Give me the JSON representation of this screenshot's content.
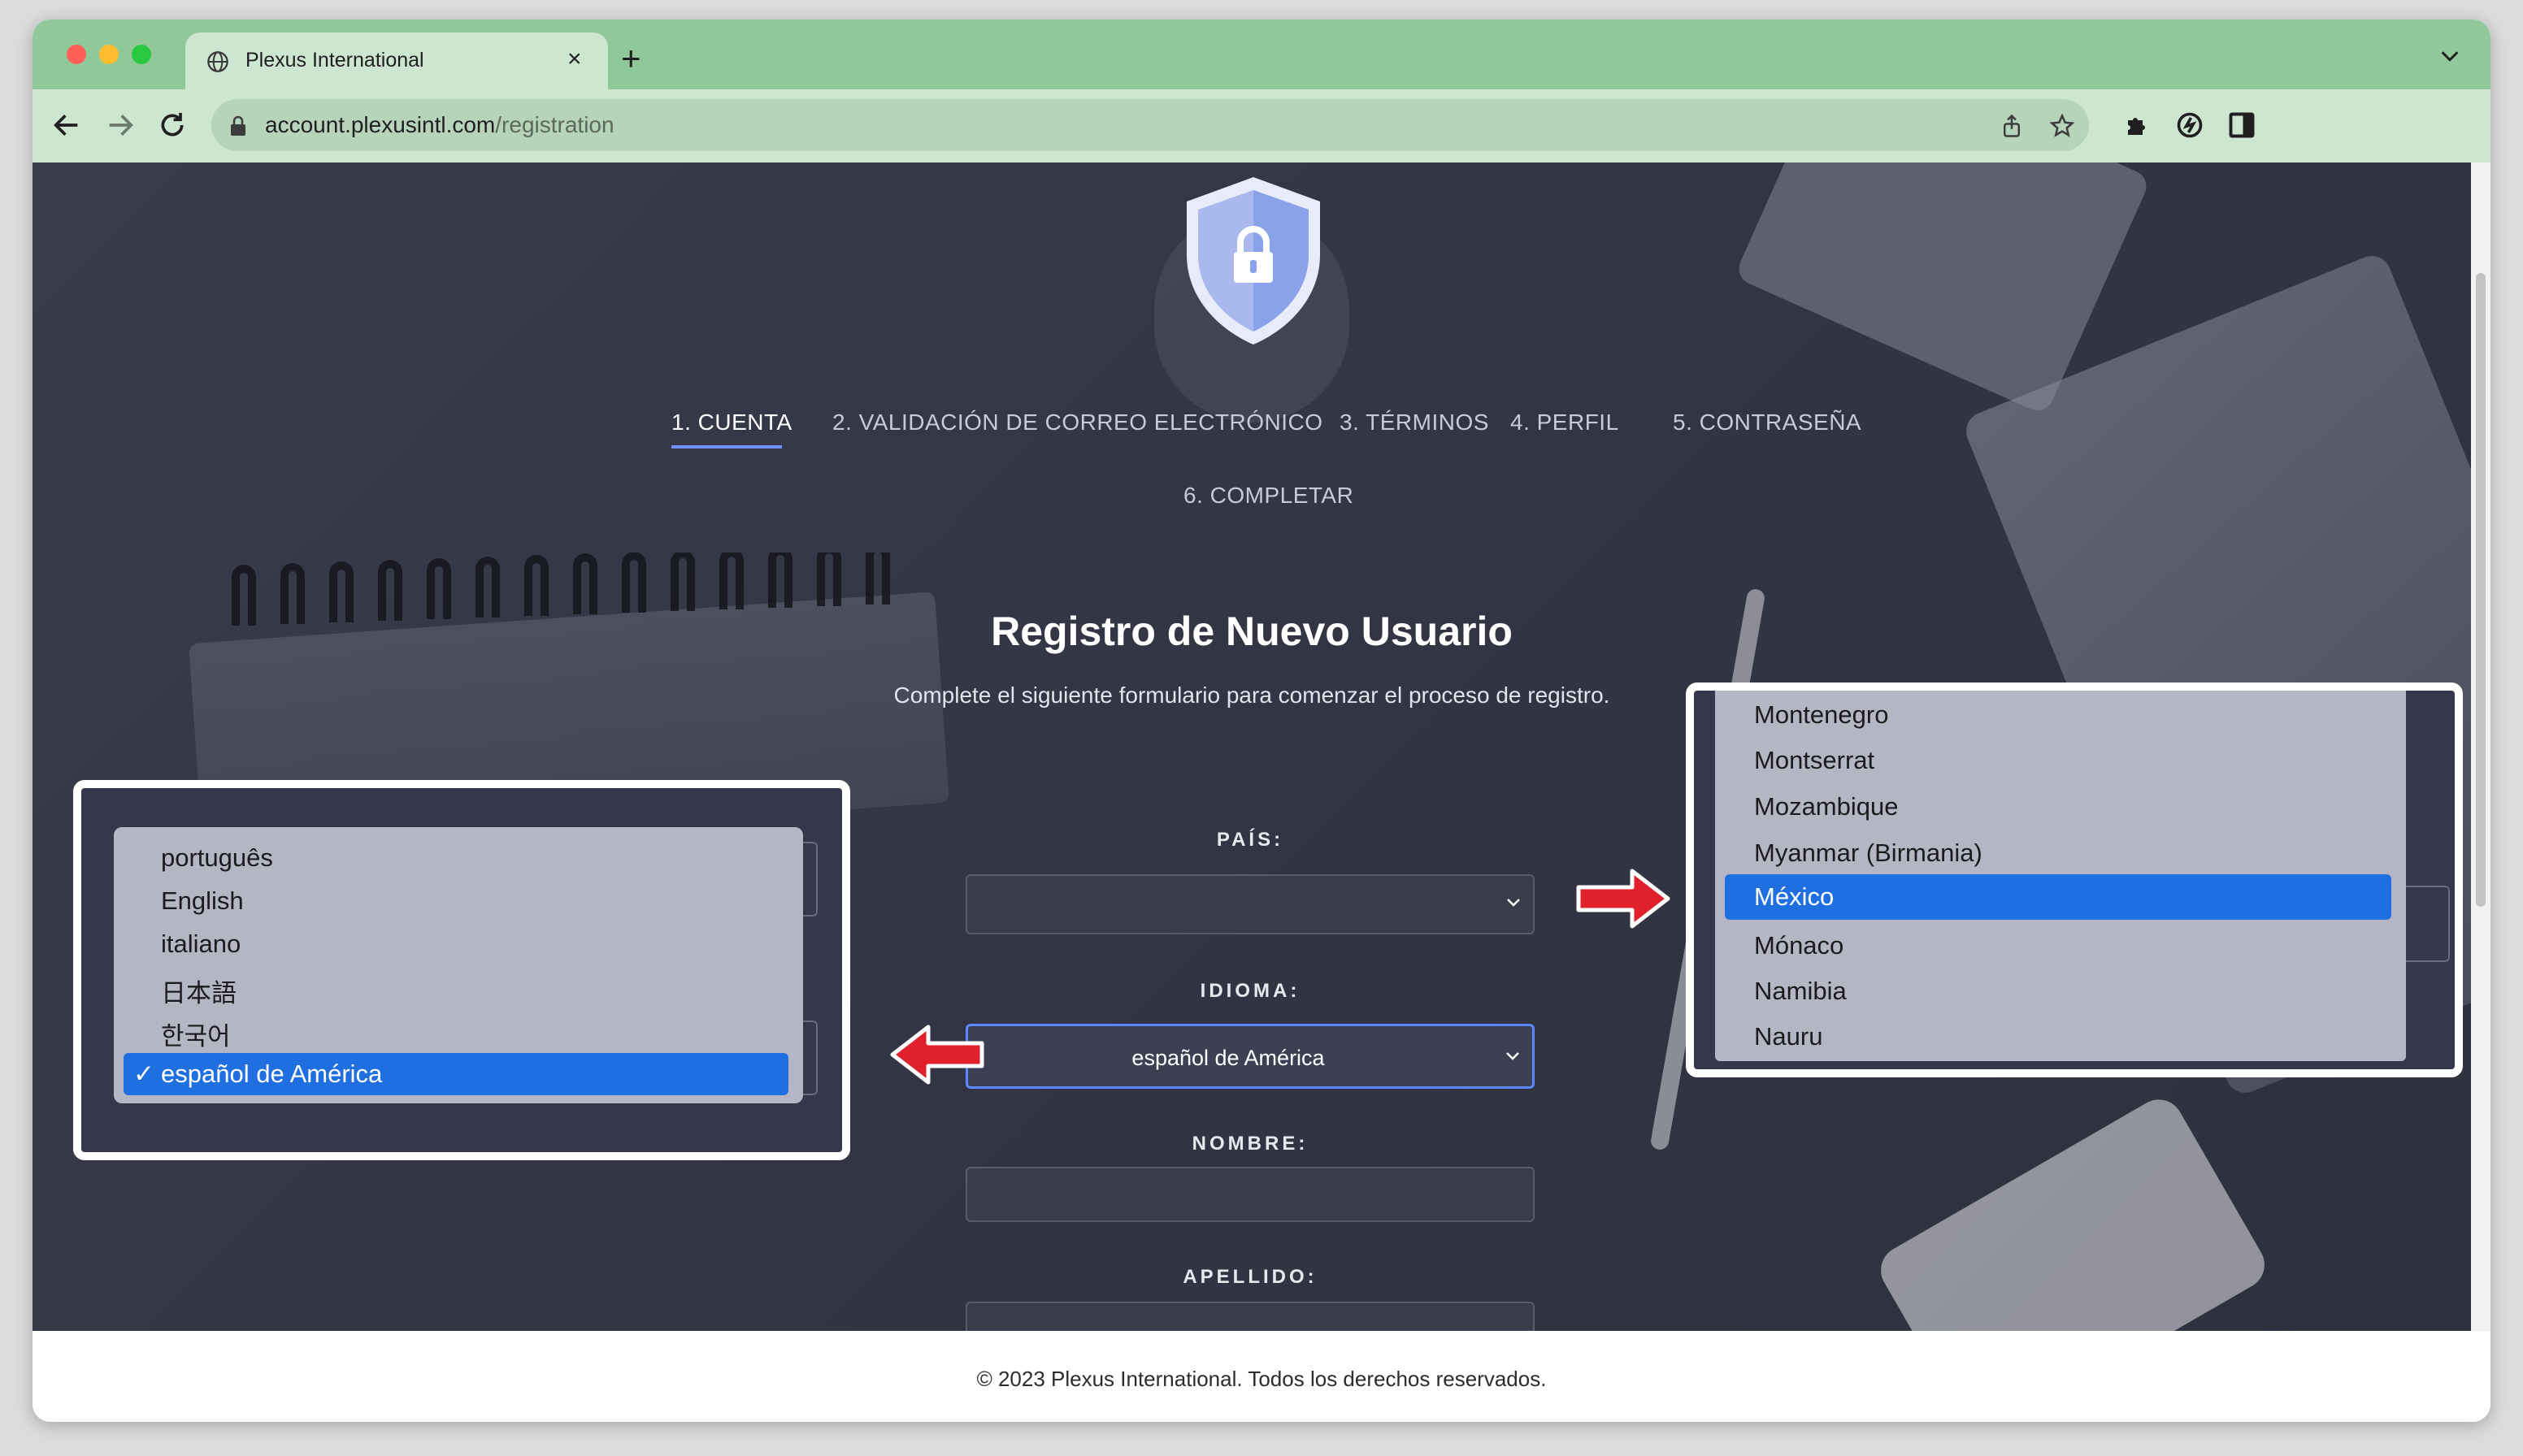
{
  "browser": {
    "tab_title": "Plexus International",
    "close_glyph": "×",
    "new_tab_glyph": "+",
    "url_host": "account.plexusintl.com",
    "url_path": "/registration"
  },
  "steps": [
    {
      "label": "1. CUENTA",
      "active": true
    },
    {
      "label": "2. VALIDACIÓN DE CORREO ELECTRÓNICO",
      "active": false
    },
    {
      "label": "3. TÉRMINOS",
      "active": false
    },
    {
      "label": "4. PERFIL",
      "active": false
    },
    {
      "label": "5. CONTRASEÑA",
      "active": false
    },
    {
      "label": "6. COMPLETAR",
      "active": false
    }
  ],
  "form": {
    "title": "Registro de Nuevo Usuario",
    "subtitle": "Complete el siguiente formulario para comenzar el proceso de registro.",
    "country_label": "PAÍS:",
    "country_value": "",
    "language_label": "IDIOMA:",
    "language_value": "español de América",
    "first_name_label": "NOMBRE:",
    "last_name_label": "APELLIDO:"
  },
  "language_dropdown": {
    "options": [
      "português",
      "English",
      "italiano",
      "日本語",
      "한국어"
    ],
    "selected": "español de América",
    "check_glyph": "✓"
  },
  "country_dropdown": {
    "options_before": [
      "Montenegro",
      "Montserrat",
      "Mozambique",
      "Myanmar (Birmania)"
    ],
    "selected": "México",
    "options_after": [
      "Mónaco",
      "Namibia",
      "Nauru"
    ]
  },
  "footer": {
    "copyright": "© 2023 Plexus International. Todos los derechos reservados."
  },
  "colors": {
    "tabstrip": "#90c89a",
    "toolbar": "#cde6d0",
    "accent": "#1f6fe0",
    "arrow": "#e0202a"
  }
}
